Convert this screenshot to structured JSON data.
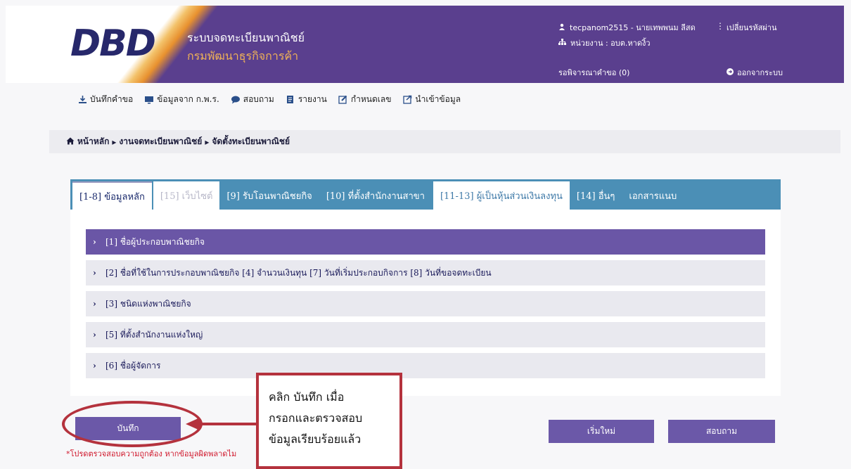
{
  "header": {
    "logo_text": "DBD",
    "system_title": "ระบบจดทะเบียนพาณิชย์",
    "department": "กรมพัฒนาธุรกิจการค้า",
    "user": "tecpanom2515 - นายเทพพนม ลีสด",
    "change_password": "เปลี่ยนรหัสผ่าน",
    "unit": "หน่วยงาน : อบต.หาดงิ้ว",
    "pending": "รอพิจารณาคำขอ (0)",
    "logout": "ออกจากระบบ"
  },
  "toolbar": {
    "items": [
      {
        "label": "บันทึกคำขอ",
        "icon": "download-icon"
      },
      {
        "label": "ข้อมูลจาก ก.พ.ร.",
        "icon": "monitor-icon"
      },
      {
        "label": "สอบถาม",
        "icon": "chat-icon"
      },
      {
        "label": "รายงาน",
        "icon": "document-icon"
      },
      {
        "label": "กำหนดเลข",
        "icon": "edit-icon"
      },
      {
        "label": "นำเข้าข้อมูล",
        "icon": "import-icon"
      }
    ]
  },
  "breadcrumb": {
    "home": "หน้าหลัก",
    "section": "งานจดทะเบียนพาณิชย์",
    "current": "จัดตั้งทะเบียนพาณิชย์"
  },
  "tabs": [
    {
      "label": "[1-8] ข้อมูลหลัก",
      "state": "active"
    },
    {
      "label": "[15] เว็บไซต์",
      "state": "muted"
    },
    {
      "label": "[9] รับโอนพาณิชยกิจ",
      "state": "normal"
    },
    {
      "label": "[10] ที่ตั้งสำนักงานสาขา",
      "state": "normal"
    },
    {
      "label": "[11-13] ผู้เป็นหุ้นส่วนเงินลงทุน",
      "state": "light"
    },
    {
      "label": "[14] อื่นๆ",
      "state": "normal"
    },
    {
      "label": "เอกสารแนบ",
      "state": "normal"
    }
  ],
  "sections": [
    {
      "label": "[1] ชื่อผู้ประกอบพาณิชยกิจ",
      "open": true
    },
    {
      "label": "[2] ชื่อที่ใช้ในการประกอบพาณิชยกิจ [4] จำนวนเงินทุน [7] วันที่เริ่มประกอบกิจการ [8] วันที่ขอจดทะเบียน",
      "open": false
    },
    {
      "label": "[3] ชนิดแห่งพาณิชยกิจ",
      "open": false
    },
    {
      "label": "[5] ที่ตั้งสำนักงานแห่งใหญ่",
      "open": false
    },
    {
      "label": "[6] ชื่อผู้จัดการ",
      "open": false
    }
  ],
  "buttons": {
    "save": "บันทึก",
    "reset": "เริ่มใหม่",
    "inquire": "สอบถาม"
  },
  "warning": "*โปรดตรวจสอบความถูกต้อง หากข้อมูลผิดพลาดไม",
  "callout": {
    "line1": "คลิก บันทึก เมื่อ",
    "line2": "กรอกและตรวจสอบ",
    "line3": "ข้อมูลเรียบร้อยแล้ว"
  },
  "colors": {
    "header": "#5a3f8e",
    "tab_bar": "#4b8fb6",
    "accordion_open": "#6a56a6",
    "button": "#6b58a8",
    "warning": "#d0182c",
    "annotation": "#b4323d"
  }
}
